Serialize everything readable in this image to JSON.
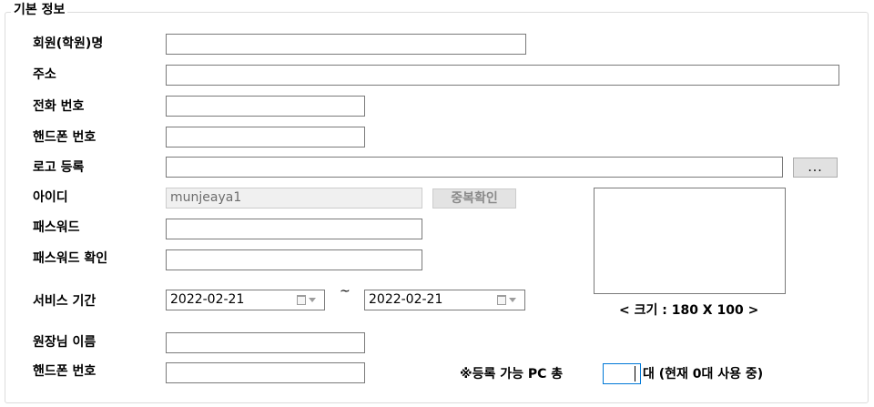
{
  "group_title": "기본 정보",
  "labels": {
    "member_name": "회원(학원)명",
    "address": "주소",
    "phone": "전화 번호",
    "mobile": "핸드폰 번호",
    "logo": "로고 등록",
    "user_id": "아이디",
    "password": "패스워드",
    "password_confirm": "패스워드 확인",
    "service_period": "서비스 기간",
    "director_name": "원장님 이름",
    "director_mobile": "핸드폰 번호"
  },
  "fields": {
    "member_name": "",
    "address": "",
    "phone": "",
    "mobile": "",
    "logo_path": "",
    "user_id": "munjeaya1",
    "password": "",
    "password_confirm": "",
    "director_name": "",
    "director_mobile": "",
    "pc_count": ""
  },
  "buttons": {
    "browse": "...",
    "duplicate_check": "중복확인"
  },
  "service_period": {
    "start": "2022-02-21",
    "separator": "~",
    "end": "2022-02-21"
  },
  "logo_size_note": "< 크기 : 180 X 100 >",
  "pc": {
    "label": "※등록 가능 PC 총",
    "suffix": "대 (현재 0대 사용 중)"
  }
}
